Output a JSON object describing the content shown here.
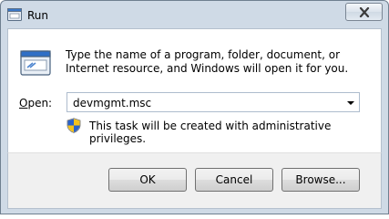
{
  "window": {
    "title": "Run"
  },
  "description": "Type the name of a program, folder, document, or Internet resource, and Windows will open it for you.",
  "open": {
    "label_accel": "O",
    "label_rest": "pen:",
    "value": "devmgmt.msc"
  },
  "admin_note": "This task will be created with administrative privileges.",
  "buttons": {
    "ok": "OK",
    "cancel": "Cancel",
    "browse": "Browse..."
  },
  "icons": {
    "title": "run-icon",
    "main": "run-program-icon",
    "shield": "uac-shield-icon",
    "close": "close-icon",
    "dropdown": "chevron-down-icon"
  }
}
